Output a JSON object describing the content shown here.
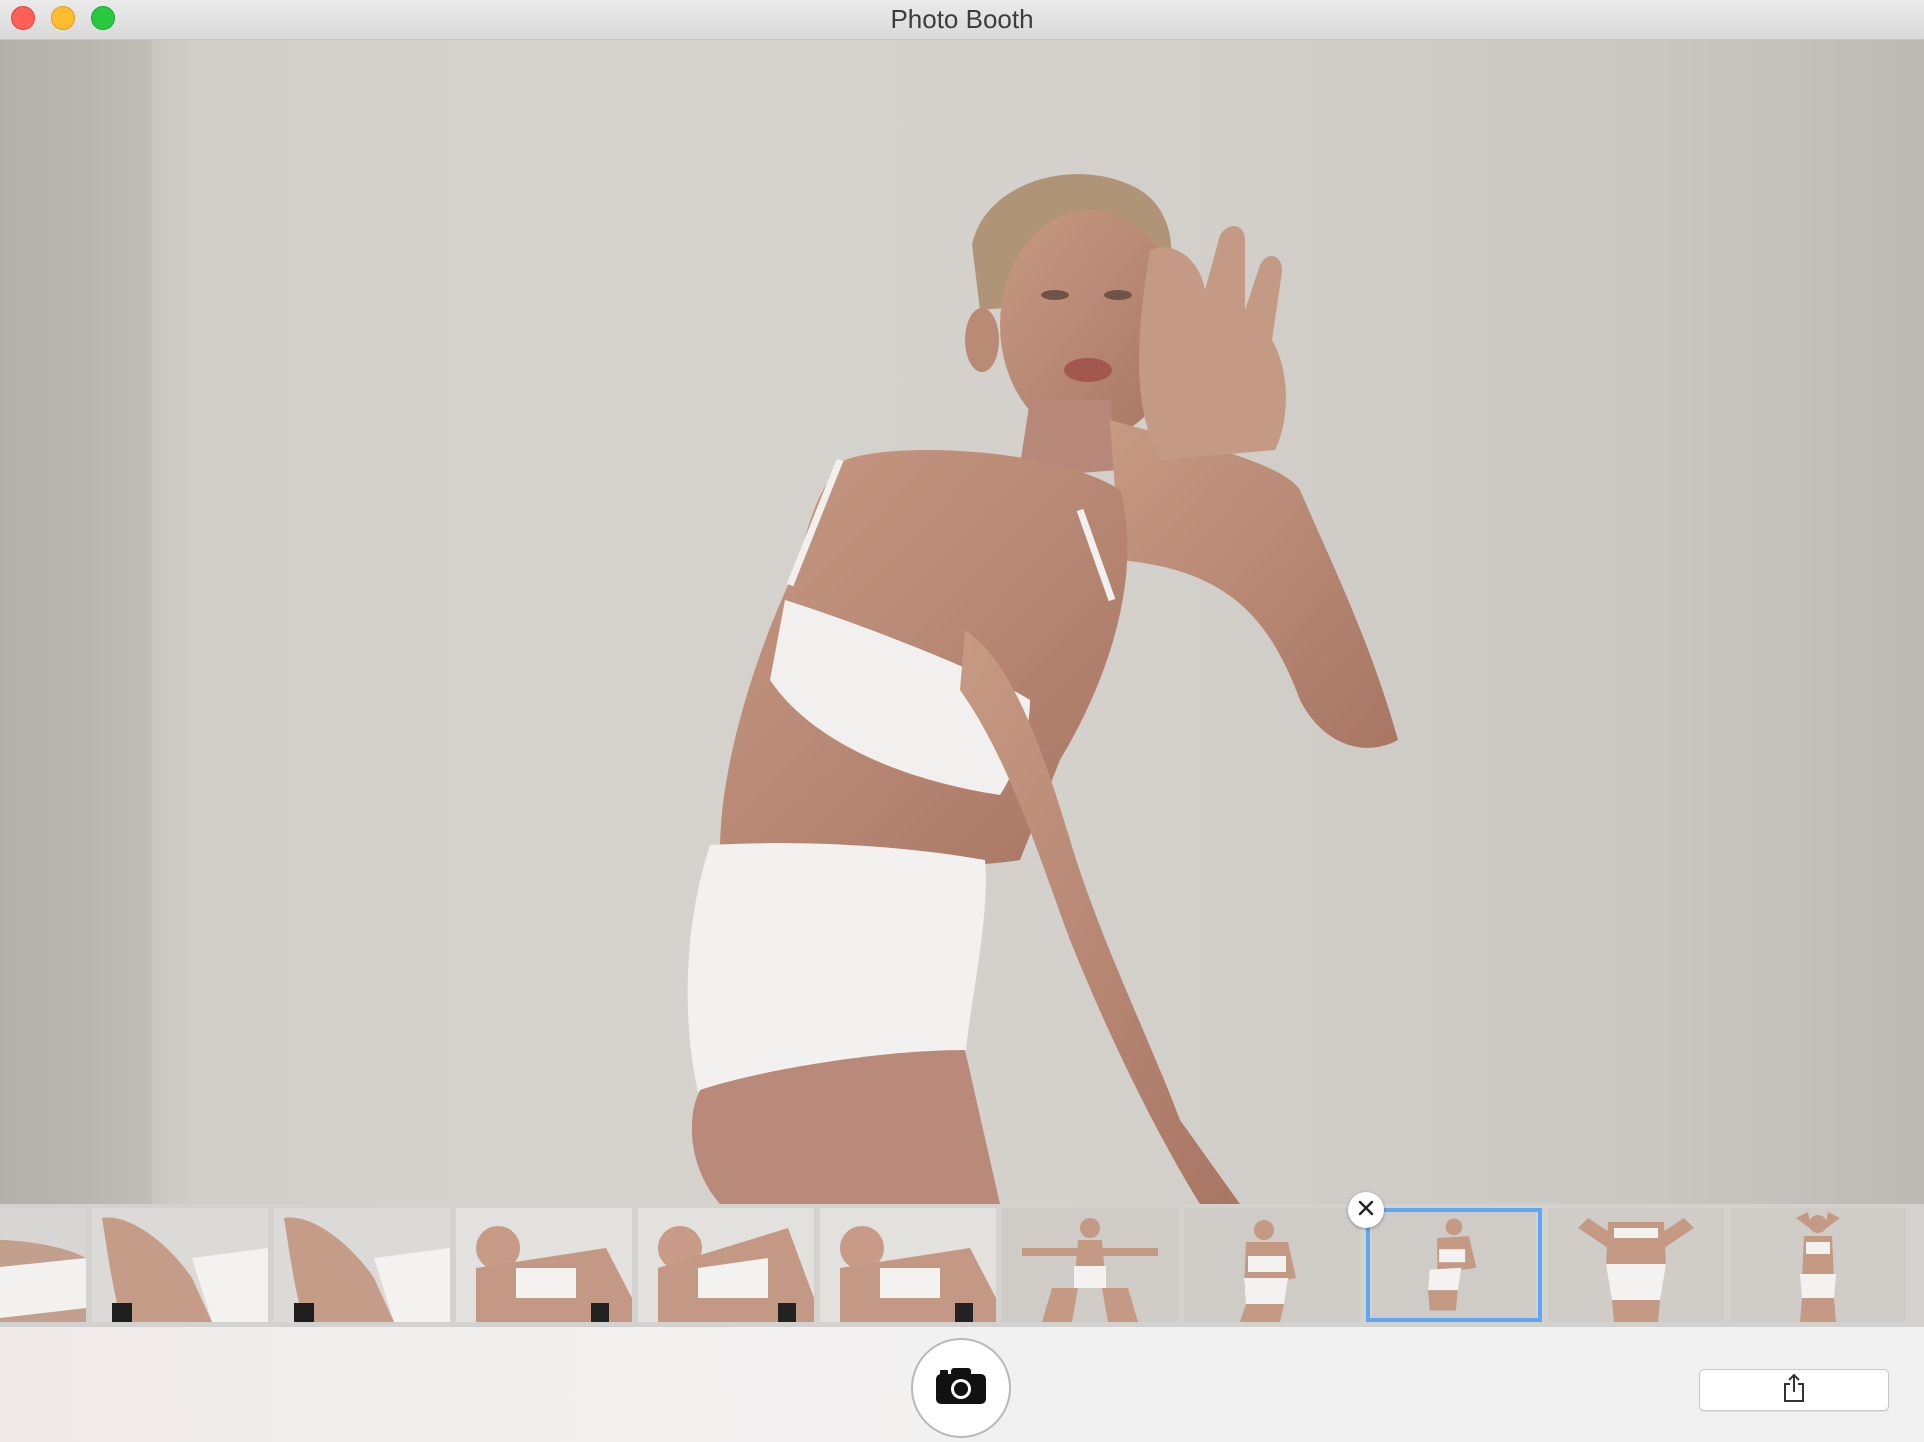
{
  "window": {
    "title": "Photo Booth"
  },
  "photo": {
    "subject": "person-portrait"
  },
  "filmstrip": {
    "selected_index": 8,
    "thumbnails": [
      {
        "scene": "torso-crop"
      },
      {
        "scene": "legs-up"
      },
      {
        "scene": "legs-up"
      },
      {
        "scene": "lounging-close"
      },
      {
        "scene": "lounging-close"
      },
      {
        "scene": "lounging-close"
      },
      {
        "scene": "arms-out"
      },
      {
        "scene": "hand-to-face"
      },
      {
        "scene": "hand-to-face"
      },
      {
        "scene": "back-view"
      },
      {
        "scene": "arms-up"
      }
    ]
  },
  "icons": {
    "close": "close-button",
    "minimize": "minimize-button",
    "zoom": "zoom-button",
    "delete": "x-mark-icon",
    "shutter": "camera-icon",
    "share": "share-icon"
  },
  "colors": {
    "selection": "#5fa6f3",
    "close": "#fe5f57",
    "minimize": "#febc2e",
    "zoom": "#28c840"
  }
}
